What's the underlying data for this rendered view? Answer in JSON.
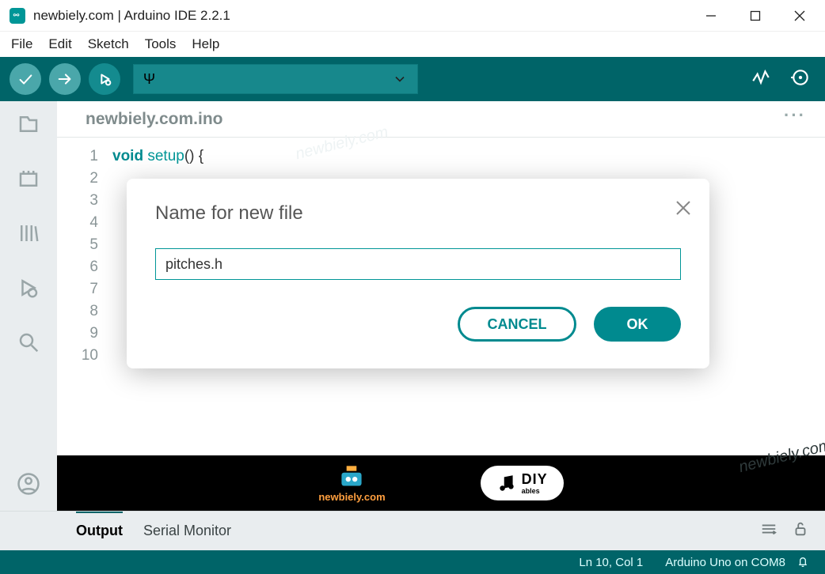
{
  "window": {
    "title": "newbiely.com | Arduino IDE 2.2.1"
  },
  "menu": {
    "items": [
      "File",
      "Edit",
      "Sketch",
      "Tools",
      "Help"
    ]
  },
  "toolbar": {
    "board_hint": "ψ"
  },
  "tab": {
    "name": "newbiely.com.ino",
    "more": "···"
  },
  "code": {
    "kw_void": "void",
    "kw_setup": "setup",
    "line1_tail": "() {"
  },
  "line_numbers": [
    "1",
    "2",
    "3",
    "4",
    "5",
    "6",
    "7",
    "8",
    "9",
    "10"
  ],
  "output": {
    "tab1": "Output",
    "tab2": "Serial Monitor"
  },
  "status": {
    "pos": "Ln 10, Col 1",
    "board": "Arduino Uno on COM8"
  },
  "dialog": {
    "title": "Name for new file",
    "value": "pitches.h",
    "cancel": "CANCEL",
    "ok": "OK"
  },
  "banner": {
    "logo1_text": "newbiely.com",
    "logo2_big": "DIY",
    "logo2_small": "ables"
  },
  "watermark": "newbiely.com"
}
